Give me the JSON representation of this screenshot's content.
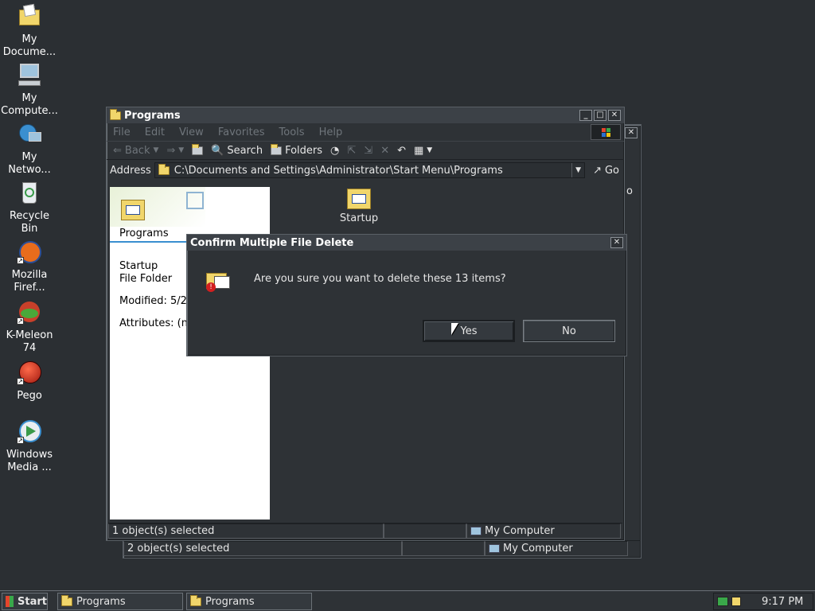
{
  "desktop": {
    "icons": [
      {
        "label": "My Docume..."
      },
      {
        "label": "My Compute..."
      },
      {
        "label": "My Netwo..."
      },
      {
        "label": "Recycle Bin"
      },
      {
        "label": "Mozilla Firef..."
      },
      {
        "label": "K-Meleon 74"
      },
      {
        "label": "Pego"
      },
      {
        "label": "Windows Media ..."
      }
    ]
  },
  "back_window": {
    "status_left": "2 object(s) selected",
    "status_right": "My Computer",
    "side_letter": "o"
  },
  "explorer": {
    "title": "Programs",
    "menu": [
      "File",
      "Edit",
      "View",
      "Favorites",
      "Tools",
      "Help"
    ],
    "toolbar": {
      "back": "Back",
      "search": "Search",
      "folders": "Folders"
    },
    "address": {
      "label": "Address",
      "path": "C:\\Documents and Settings\\Administrator\\Start Menu\\Programs",
      "go": "Go"
    },
    "left_panel": {
      "folder_title": "Programs",
      "item_name": "Startup",
      "item_type": "File Folder",
      "modified": "Modified: 5/2",
      "attributes": "Attributes: (no"
    },
    "content_item": "Startup",
    "status_left": "1 object(s) selected",
    "status_right": "My Computer"
  },
  "dialog": {
    "title": "Confirm Multiple File Delete",
    "message": "Are you sure you want to delete these 13 items?",
    "yes": "Yes",
    "no": "No"
  },
  "taskbar": {
    "start": "Start",
    "tasks": [
      "Programs",
      "Programs"
    ],
    "clock": "9:17 PM"
  },
  "colors": {
    "desktop_bg": "#2b2f33",
    "window_bg": "#2e3236",
    "titlebar": "#3c4147",
    "folder_yellow": "#f1d66b"
  }
}
